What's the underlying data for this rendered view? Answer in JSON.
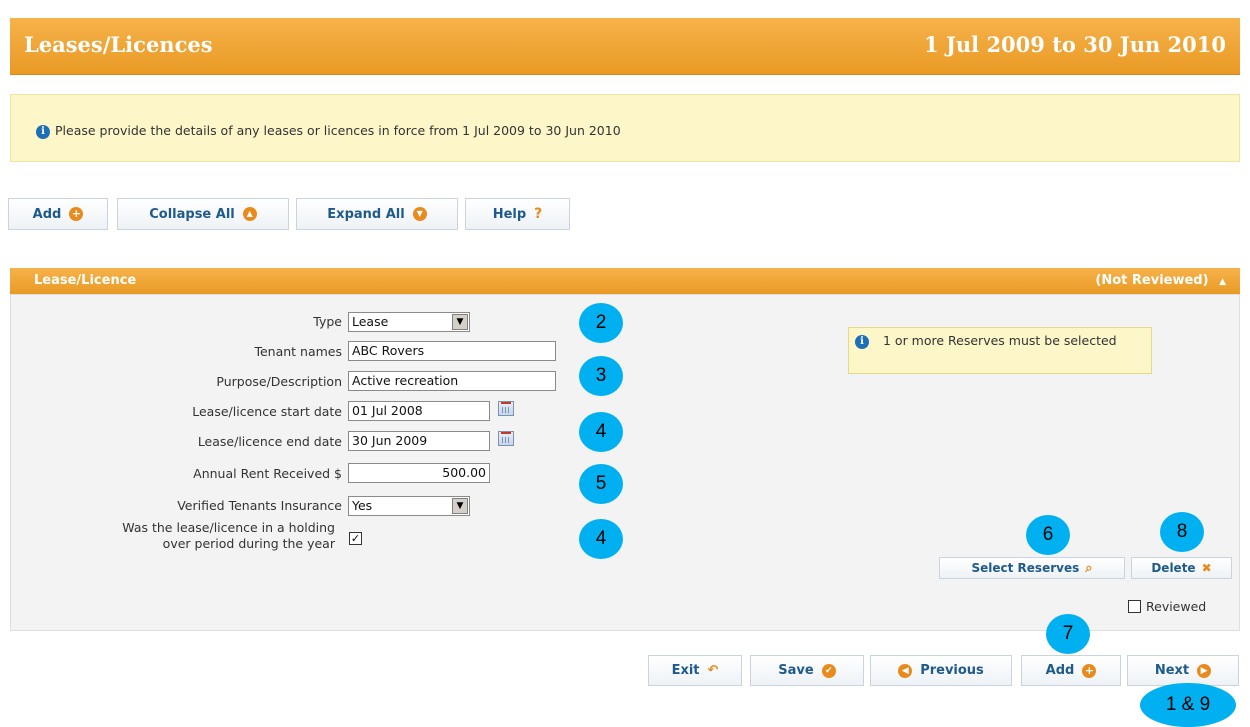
{
  "header": {
    "title": "Leases/Licences",
    "period": "1 Jul 2009 to 30 Jun 2010"
  },
  "info": {
    "message": "Please provide the details of any leases or licences in force from 1 Jul 2009 to 30 Jun 2010",
    "icon": "info-icon"
  },
  "toolbar": {
    "add": "Add",
    "collapse_all": "Collapse All",
    "expand_all": "Expand All",
    "help": "Help",
    "help_icon": "?"
  },
  "panel": {
    "title": "Lease/Licence",
    "status": "(Not Reviewed)",
    "status_icon": "▲",
    "form": {
      "type_label": "Type",
      "type_value": "Lease",
      "tenant_label": "Tenant names",
      "tenant_value": "ABC Rovers",
      "purpose_label": "Purpose/Description",
      "purpose_value": "Active recreation",
      "start_label": "Lease/licence start date",
      "start_value": "01 Jul 2008",
      "end_label": "Lease/licence end date",
      "end_value": "30 Jun 2009",
      "rent_label": "Annual Rent Received $",
      "rent_value": "500.00",
      "insurance_label": "Verified Tenants Insurance",
      "insurance_value": "Yes",
      "holding_label_1": "Was the lease/licence in a holding",
      "holding_label_2": "over period during the year",
      "holding_checked": true
    },
    "note": "1 or more Reserves must be selected",
    "select_reserves": "Select Reserves",
    "delete": "Delete",
    "reviewed_label": "Reviewed",
    "reviewed_checked": false
  },
  "footer": {
    "exit": "Exit",
    "save": "Save",
    "previous": "Previous",
    "add": "Add",
    "next": "Next"
  },
  "callouts": [
    "2",
    "3",
    "4",
    "5",
    "4",
    "6",
    "8",
    "7",
    "1 & 9"
  ],
  "colors": {
    "orange": "#e99a24",
    "link_blue": "#1e5a8c",
    "callout": "#00b0f0",
    "info_bg": "#fdf6c8"
  }
}
